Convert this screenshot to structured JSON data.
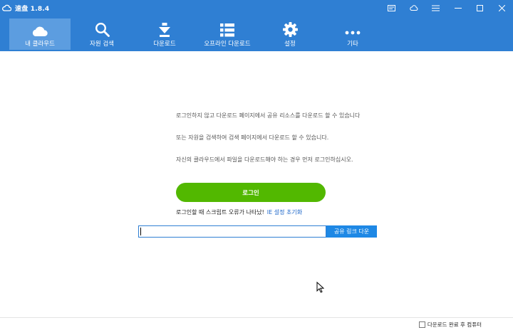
{
  "app": {
    "title": "速盘 1.8.4"
  },
  "toolbar": {
    "items": [
      {
        "label": "내 클라우드",
        "icon": "cloud-icon",
        "active": true
      },
      {
        "label": "자원 검색",
        "icon": "search-icon",
        "active": false
      },
      {
        "label": "다운로드",
        "icon": "download-icon",
        "active": false
      },
      {
        "label": "오프라인 다운로드",
        "icon": "list-icon",
        "active": false
      },
      {
        "label": "설정",
        "icon": "gear-icon",
        "active": false
      },
      {
        "label": "기타",
        "icon": "more-icon",
        "active": false
      }
    ]
  },
  "main": {
    "messages": [
      "로그인하지 않고 다운로드 페이지에서 공유 리소스를 다운로드 할 수 있습니다",
      "또는 자원을 검색하여 검색 페이지에서 다운로드 할 수 있습니다.",
      "자신의 클라우드에서 파일을 다운로드해야 하는 경우 먼저 로그인하십시오."
    ],
    "login_label": "로그인",
    "error_text": "로그인할 때 스크립트 오류가 나타났!",
    "ie_reset_link": "IE 설정 초기화",
    "share_input_value": "",
    "share_button_label": "공유 링크 다운"
  },
  "status": {
    "shutdown_label": "다운로드 완료 후 컴퓨터"
  },
  "colors": {
    "accent": "#2f7fd3",
    "login": "#52b800",
    "link": "#1a64c8"
  }
}
